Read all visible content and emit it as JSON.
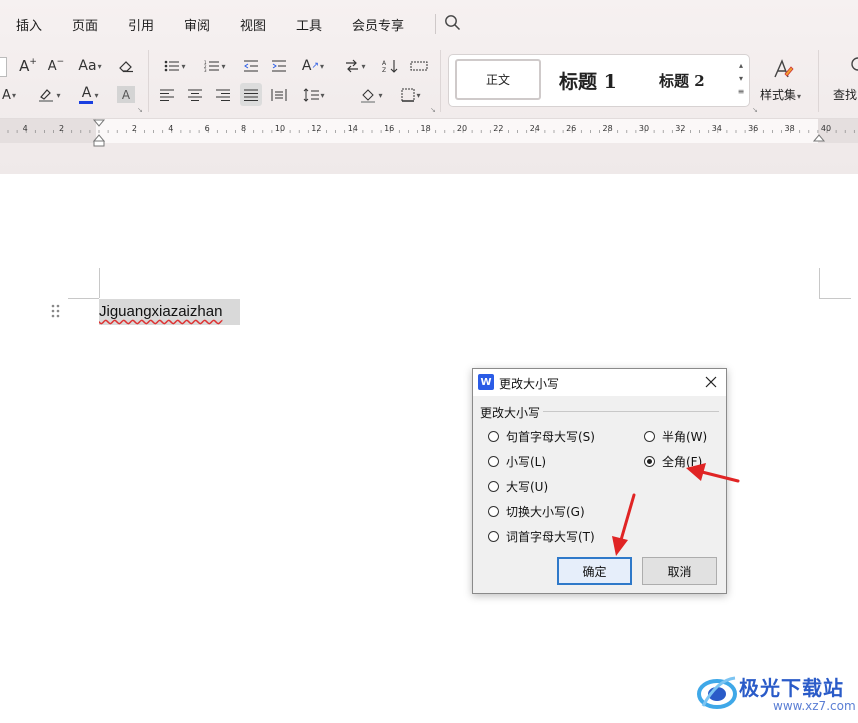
{
  "menu": {
    "items": [
      "插入",
      "页面",
      "引用",
      "审阅",
      "视图",
      "工具",
      "会员专享"
    ]
  },
  "ribbon": {
    "font_size_inc": "A",
    "font_size_dec": "A",
    "change_case": "Aa",
    "style_set_label": "样式集",
    "find_label": "查找",
    "char_shading": "A"
  },
  "styles": {
    "normal": "正文",
    "heading1": "标题 1",
    "heading2": "标题 2"
  },
  "ruler": {
    "labels": [
      "4",
      "2",
      "2",
      "4",
      "6",
      "8",
      "10",
      "12",
      "14",
      "16",
      "18",
      "20",
      "22",
      "24",
      "26",
      "28",
      "30",
      "32",
      "34",
      "36",
      "38",
      "40"
    ]
  },
  "document": {
    "text": "Jiguangxiazaizhan"
  },
  "dialog": {
    "title": "更改大小写",
    "group_label": "更改大小写",
    "options_left": [
      {
        "label": "句首字母大写(S)",
        "checked": false
      },
      {
        "label": "小写(L)",
        "checked": false
      },
      {
        "label": "大写(U)",
        "checked": false
      },
      {
        "label": "切换大小写(G)",
        "checked": false
      },
      {
        "label": "词首字母大写(T)",
        "checked": false
      }
    ],
    "options_right": [
      {
        "label": "半角(W)",
        "checked": false
      },
      {
        "label": "全角(F)",
        "checked": true
      }
    ],
    "ok_label": "确定",
    "cancel_label": "取消"
  },
  "watermark": {
    "text": "极光下载站",
    "url": "www.xz7.com"
  },
  "colors": {
    "annotation_arrow": "#e02424",
    "accent_blue": "#2b5ce6",
    "font_color_bar": "#1a3fe0"
  }
}
